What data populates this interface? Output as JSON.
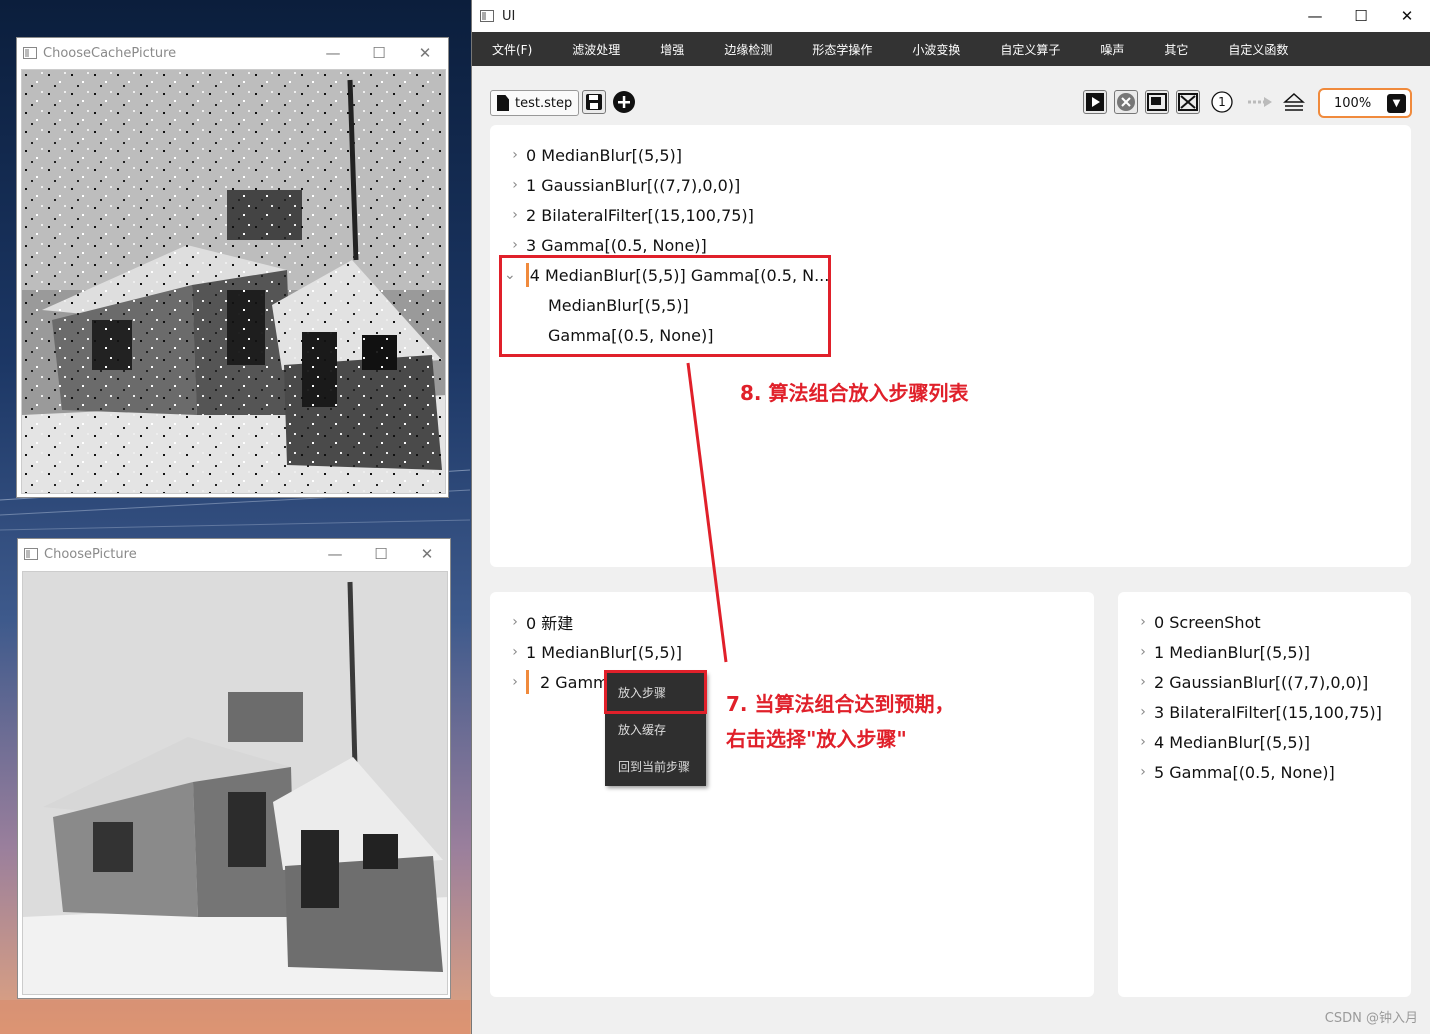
{
  "cache_window": {
    "title": "ChooseCachePicture"
  },
  "choose_window": {
    "title": "ChoosePicture"
  },
  "window_controls": {
    "minimize": "—",
    "maximize": "☐",
    "close": "✕"
  },
  "main": {
    "title": "UI",
    "menu": [
      "文件(F)",
      "滤波处理",
      "增强",
      "边缘检测",
      "形态学操作",
      "小波变换",
      "自定义算子",
      "噪声",
      "其它",
      "自定义函数"
    ],
    "toolbar": {
      "file_label": "test.step",
      "zoom": "100%",
      "step_number": "1"
    }
  },
  "steps_list": [
    "0 MedianBlur[(5,5)]",
    "1 GaussianBlur[((7,7),0,0)]",
    "2 BilateralFilter[(15,100,75)]",
    "3 Gamma[(0.5, None)]",
    "4 MedianBlur[(5,5)] Gamma[(0.5, N..."
  ],
  "steps_children": [
    "MedianBlur[(5,5)]",
    "Gamma[(0.5, None)]"
  ],
  "combo_list": [
    "0 新建",
    "1 MedianBlur[(5,5)]",
    "2 Gamm"
  ],
  "cache_list": [
    "0 ScreenShot",
    "1 MedianBlur[(5,5)]",
    "2 GaussianBlur[((7,7),0,0)]",
    "3 BilateralFilter[(15,100,75)]",
    "4 MedianBlur[(5,5)]",
    "5 Gamma[(0.5, None)]"
  ],
  "context_menu": [
    "放入步骤",
    "放入缓存",
    "回到当前步骤"
  ],
  "annotations": {
    "step8": "8. 算法组合放入步骤列表",
    "step7_line1": "7. 当算法组合达到预期，",
    "step7_line2": "右击选择\"放入步骤\""
  },
  "watermark": "CSDN @钟入月",
  "colors": {
    "menubar": "#333333",
    "accent_orange": "#f08a3c",
    "annotation_red": "#e0202a"
  }
}
